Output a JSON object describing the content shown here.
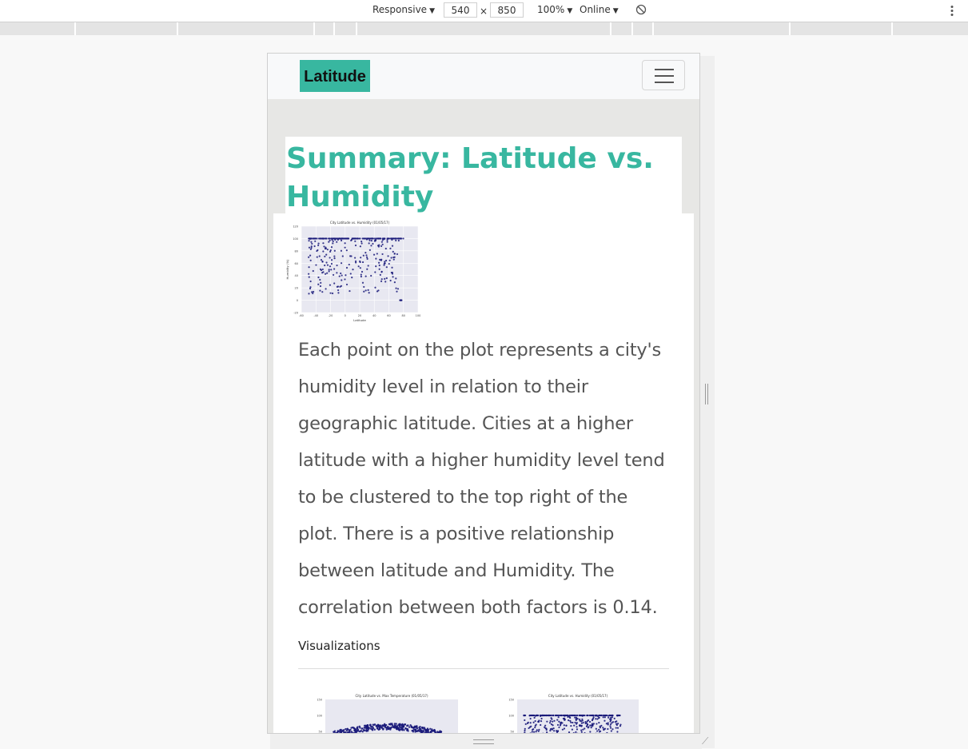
{
  "devtools": {
    "device": "Responsive",
    "width": "540",
    "times": "×",
    "height": "850",
    "zoom": "100%",
    "network": "Online",
    "dropdown_glyph": "▼",
    "rotate_icon": "rotate-icon",
    "menu_icon": "more-vert-icon"
  },
  "navbar": {
    "brand": "Latitude",
    "toggler_icon": "hamburger-icon"
  },
  "page": {
    "title": "Summary: Latitude vs. Humidity",
    "paragraph": "Each point on the plot represents a city's humidity level in relation to their geographic latitude. Cities at a higher latitude with a higher humidity level tend to be clustered to the top right of the plot. There is a positive relationship between latitude and Humidity. The correlation between both factors is 0.14.",
    "section_label": "Visualizations"
  },
  "colors": {
    "accent": "#38b7a0",
    "point": "#1a1a7a",
    "plot_bg": "#e8e8f1"
  },
  "chart_data": [
    {
      "type": "scatter",
      "title": "City Latitude vs. Humidity (01/05/17)",
      "xlabel": "Latitude",
      "ylabel": "Humidity (%)",
      "xlim": [
        -60,
        100
      ],
      "ylim": [
        -20,
        120
      ],
      "xticks": [
        -60,
        -40,
        -20,
        0,
        20,
        40,
        60,
        80,
        100
      ],
      "yticks": [
        -20,
        0,
        20,
        40,
        60,
        80,
        100,
        120
      ],
      "grid": true
    },
    {
      "type": "scatter",
      "title": "City Latitude vs. Max Temperature (01/05/17)",
      "yticks": [
        50,
        100,
        150
      ]
    },
    {
      "type": "scatter",
      "title": "City Latitude vs. Humidity (01/05/17)",
      "yticks": [
        50,
        100,
        150
      ]
    }
  ]
}
